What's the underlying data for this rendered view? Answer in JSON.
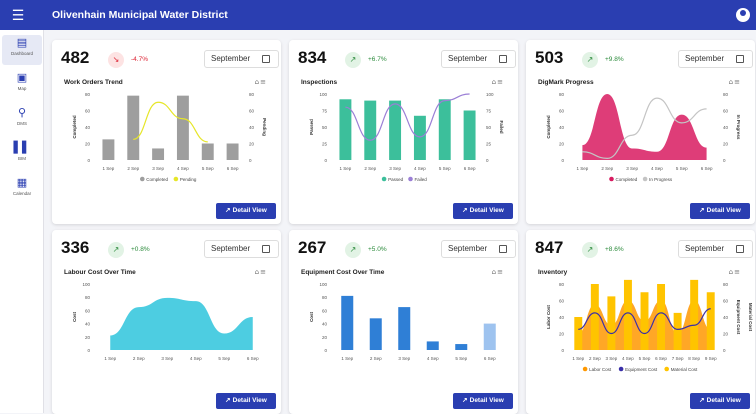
{
  "app": {
    "title": "Olivenhain Municipal Water District"
  },
  "sidebar": [
    {
      "label": "Dashboard",
      "icon": "dashboard-icon"
    },
    {
      "label": "Map",
      "icon": "map-icon"
    },
    {
      "label": "DMS",
      "icon": "search-icon"
    },
    {
      "label": "BIM",
      "icon": "bar-chart-icon"
    },
    {
      "label": "Calendar",
      "icon": "calendar-icon"
    }
  ],
  "cards": [
    {
      "metric": "482",
      "change": "-4.7%",
      "trend": "down",
      "month": "September",
      "chart_title": "Work Orders Trend",
      "button": "Detail View",
      "chart_data": {
        "type": "bar",
        "categories": [
          "1 Sep",
          "2 Sep",
          "3 Sep",
          "4 Sep",
          "5 Sep",
          "6 Sep"
        ],
        "series": [
          {
            "name": "Completed",
            "kind": "bar",
            "color": "#9e9e9e",
            "values": [
              25,
              78,
              14,
              78,
              20,
              20
            ]
          },
          {
            "name": "Pending",
            "kind": "line",
            "color": "#e6e629",
            "values": [
              null,
              25,
              70,
              50,
              22,
              null
            ]
          }
        ],
        "ylabel": "Completed",
        "y2label": "Pending",
        "yticks": [
          "0",
          "20",
          "40",
          "60",
          "80"
        ],
        "y2ticks": [
          "0",
          "20",
          "40",
          "60",
          "80"
        ],
        "ylim": [
          0,
          80
        ]
      }
    },
    {
      "metric": "834",
      "change": "+6.7%",
      "trend": "up",
      "month": "September",
      "chart_title": "Inspections",
      "button": "Detail View",
      "chart_data": {
        "type": "bar",
        "categories": [
          "1 Sep",
          "2 Sep",
          "3 Sep",
          "4 Sep",
          "5 Sep",
          "6 Sep"
        ],
        "series": [
          {
            "name": "Passed",
            "kind": "bar",
            "color": "#3cbf9b",
            "values": [
              92,
              90,
              90,
              67,
              92,
              75
            ]
          },
          {
            "name": "Failed",
            "kind": "line",
            "color": "#9b7fd6",
            "values": [
              80,
              30,
              85,
              35,
              90,
              100
            ]
          }
        ],
        "ylabel": "Passed",
        "y2label": "Failed",
        "yticks": [
          "0",
          "25",
          "50",
          "75",
          "100"
        ],
        "y2ticks": [
          "0",
          "25",
          "50",
          "75",
          "100"
        ],
        "ylim": [
          0,
          100
        ]
      }
    },
    {
      "metric": "503",
      "change": "+9.8%",
      "trend": "up",
      "month": "September",
      "chart_title": "DigMark Progress",
      "button": "Detail View",
      "chart_data": {
        "type": "area",
        "categories": [
          "1 Sep",
          "2 Sep",
          "3 Sep",
          "4 Sep",
          "5 Sep",
          "6 Sep"
        ],
        "series": [
          {
            "name": "Completed",
            "kind": "area",
            "color": "#d81b60",
            "values": [
              18,
              80,
              14,
              10,
              55,
              15
            ]
          },
          {
            "name": "In Progress",
            "kind": "line",
            "color": "#c4c4c4",
            "values": [
              10,
              2,
              30,
              75,
              45,
              62
            ]
          }
        ],
        "ylabel": "Completed",
        "y2label": "In Progress",
        "yticks": [
          "0",
          "20",
          "40",
          "60",
          "80"
        ],
        "y2ticks": [
          "0",
          "20",
          "40",
          "60",
          "80"
        ],
        "ylim": [
          0,
          80
        ]
      }
    },
    {
      "metric": "336",
      "change": "+0.8%",
      "trend": "up",
      "month": "September",
      "chart_title": "Labour Cost Over Time",
      "button": "Detail View",
      "chart_data": {
        "type": "area",
        "categories": [
          "1 Sep",
          "2 Sep",
          "3 Sep",
          "4 Sep",
          "5 Sep",
          "6 Sep"
        ],
        "series": [
          {
            "name": "Cost",
            "kind": "area",
            "color": "#2ec4dc",
            "values": [
              22,
              65,
              79,
              74,
              25,
              50
            ]
          }
        ],
        "ylabel": "Cost",
        "yticks": [
          "0",
          "20",
          "40",
          "60",
          "80",
          "100"
        ],
        "ylim": [
          0,
          100
        ]
      }
    },
    {
      "metric": "267",
      "change": "+5.0%",
      "trend": "up",
      "month": "September",
      "chart_title": "Equipment Cost Over Time",
      "button": "Detail View",
      "chart_data": {
        "type": "bar",
        "categories": [
          "1 Sep",
          "2 Sep",
          "3 Sep",
          "4 Sep",
          "5 Sep",
          "6 Sep"
        ],
        "series": [
          {
            "name": "Cost",
            "kind": "bar",
            "color": "#2f7fd6",
            "values": [
              82,
              48,
              65,
              13,
              9,
              40
            ],
            "last_color": "#9ec3ef"
          }
        ],
        "ylabel": "Cost",
        "yticks": [
          "0",
          "20",
          "40",
          "60",
          "80",
          "100"
        ],
        "ylim": [
          0,
          100
        ]
      }
    },
    {
      "metric": "847",
      "change": "+8.6%",
      "trend": "up",
      "month": "September",
      "chart_title": "Inventory",
      "button": "Detail View",
      "chart_data": {
        "type": "bar",
        "categories": [
          "1 Sep",
          "2 Sep",
          "3 Sep",
          "4 Sep",
          "5 Sep",
          "6 Sep",
          "7 Sep",
          "8 Sep",
          "9 Sep"
        ],
        "series": [
          {
            "name": "Labor Cost",
            "kind": "area",
            "color": "#ff9800",
            "values": [
              20,
              55,
              30,
              60,
              35,
              60,
              20,
              60,
              25
            ]
          },
          {
            "name": "Equipment Cost",
            "kind": "line",
            "color": "#3a2fa8",
            "values": [
              25,
              45,
              20,
              45,
              20,
              45,
              25,
              30,
              50
            ]
          },
          {
            "name": "Material Cost",
            "kind": "bar",
            "color": "#ffc400",
            "values": [
              40,
              80,
              65,
              85,
              70,
              80,
              45,
              85,
              70
            ]
          }
        ],
        "ylabel": "Labor Cost",
        "y2label": "Equipment Cost",
        "y3label": "Material Cost",
        "yticks": [
          "0",
          "20",
          "40",
          "60",
          "80"
        ],
        "y2ticks": [
          "0",
          "20",
          "40",
          "60",
          "80"
        ],
        "ylim": [
          0,
          80
        ]
      }
    }
  ]
}
